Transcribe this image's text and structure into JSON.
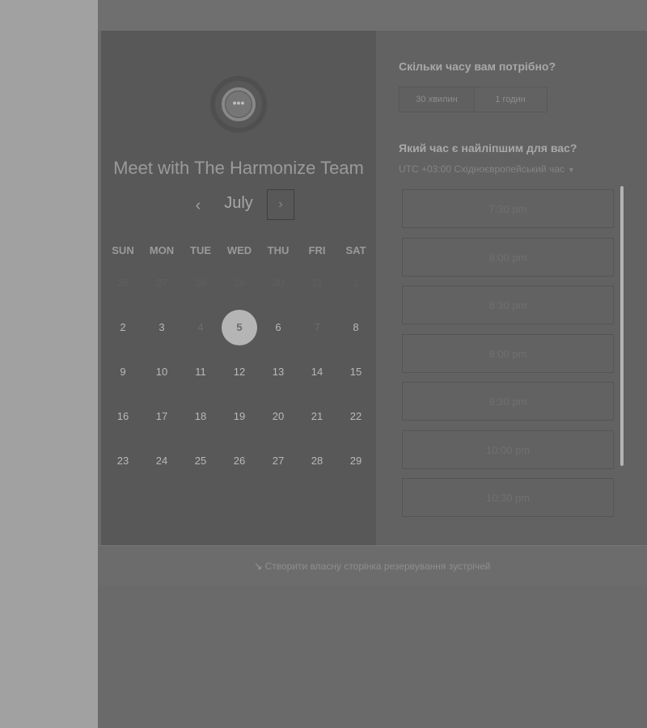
{
  "calendar": {
    "title": "Meet with The Harmonize Team",
    "month": "July",
    "prev_icon": "‹",
    "next_icon": "›",
    "logo_glyph": "•••",
    "weekdays": [
      "SUN",
      "MON",
      "TUE",
      "WED",
      "THU",
      "FRI",
      "SAT"
    ],
    "weeks": [
      [
        {
          "d": "26",
          "s": "dim"
        },
        {
          "d": "27",
          "s": "dim"
        },
        {
          "d": "28",
          "s": "dim"
        },
        {
          "d": "29",
          "s": "dim"
        },
        {
          "d": "30",
          "s": "dim"
        },
        {
          "d": "31",
          "s": "dim"
        },
        {
          "d": "1",
          "s": "dim"
        }
      ],
      [
        {
          "d": "2",
          "s": ""
        },
        {
          "d": "3",
          "s": ""
        },
        {
          "d": "4",
          "s": "muted"
        },
        {
          "d": "5",
          "s": "sel"
        },
        {
          "d": "6",
          "s": ""
        },
        {
          "d": "7",
          "s": "muted"
        },
        {
          "d": "8",
          "s": ""
        }
      ],
      [
        {
          "d": "9",
          "s": ""
        },
        {
          "d": "10",
          "s": ""
        },
        {
          "d": "11",
          "s": ""
        },
        {
          "d": "12",
          "s": ""
        },
        {
          "d": "13",
          "s": ""
        },
        {
          "d": "14",
          "s": ""
        },
        {
          "d": "15",
          "s": ""
        }
      ],
      [
        {
          "d": "16",
          "s": ""
        },
        {
          "d": "17",
          "s": ""
        },
        {
          "d": "18",
          "s": ""
        },
        {
          "d": "19",
          "s": ""
        },
        {
          "d": "20",
          "s": ""
        },
        {
          "d": "21",
          "s": ""
        },
        {
          "d": "22",
          "s": ""
        }
      ],
      [
        {
          "d": "23",
          "s": ""
        },
        {
          "d": "24",
          "s": ""
        },
        {
          "d": "25",
          "s": ""
        },
        {
          "d": "26",
          "s": ""
        },
        {
          "d": "27",
          "s": ""
        },
        {
          "d": "28",
          "s": ""
        },
        {
          "d": "29",
          "s": ""
        }
      ]
    ]
  },
  "booking": {
    "duration_question": "Скільки часу вам потрібно?",
    "durations": [
      "30 хвилин",
      "1 годин"
    ],
    "time_question": "Який час є найліпшим для вас?",
    "timezone": "UTC +03:00 Східноєвропейський час",
    "timezone_caret": "▼",
    "slots": [
      "7:30 pm",
      "8:00 pm",
      "8:30 pm",
      "9:00 pm",
      "9:30 pm",
      "10:00 pm",
      "10:30 pm"
    ]
  },
  "footer": {
    "icon": "↘",
    "text": "Створити власну сторінка резервування зустрічей"
  }
}
